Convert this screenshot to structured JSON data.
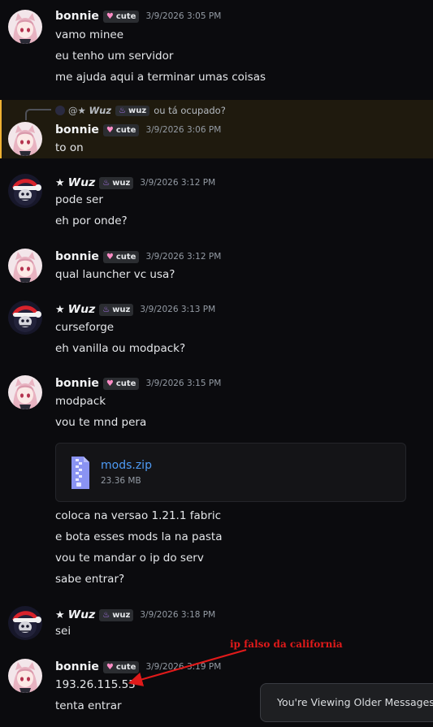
{
  "users": {
    "bonnie": {
      "name": "bonnie",
      "tag": "cute",
      "tag_icon": "heart-icon"
    },
    "wuz": {
      "name": "𝙒𝙪𝙯",
      "star": "★",
      "tag": "wuz",
      "tag_icon": "flame-icon"
    }
  },
  "reply": {
    "mention": "@★ 𝙒𝙪𝙯",
    "tag": "wuz",
    "text": "ou tá ocupado?"
  },
  "messages": [
    {
      "author": "bonnie",
      "time": "3/9/2026 3:05 PM",
      "lines": [
        "vamo minee",
        "eu tenho um servidor",
        "me ajuda aqui a terminar umas coisas"
      ]
    },
    {
      "author": "bonnie",
      "time": "3/9/2026 3:06 PM",
      "lines": [
        "to on"
      ]
    },
    {
      "author": "wuz",
      "time": "3/9/2026 3:12 PM",
      "lines": [
        "pode ser",
        "eh por onde?"
      ]
    },
    {
      "author": "bonnie",
      "time": "3/9/2026 3:12 PM",
      "lines": [
        "qual launcher vc usa?"
      ]
    },
    {
      "author": "wuz",
      "time": "3/9/2026 3:13 PM",
      "lines": [
        "curseforge",
        "eh vanilla ou modpack?"
      ]
    },
    {
      "author": "bonnie",
      "time": "3/9/2026 3:15 PM",
      "lines": [
        "modpack",
        "vou te mnd pera"
      ],
      "lines_after": [
        "coloca na versao 1.21.1 fabric",
        "e bota esses mods la na pasta",
        "vou te mandar o ip do serv",
        "sabe entrar?"
      ]
    },
    {
      "author": "wuz",
      "time": "3/9/2026 3:18 PM",
      "lines": [
        "sei"
      ]
    },
    {
      "author": "bonnie",
      "time": "3/9/2026 3:19 PM",
      "lines": [
        "193.26.115.53",
        "tenta entrar"
      ]
    }
  ],
  "attachment": {
    "name": "mods.zip",
    "size": "23.36 MB",
    "icon": "zip-file-icon"
  },
  "toast": "You're Viewing Older Messages",
  "annotation": "ip falso da california",
  "colors": {
    "accent_link": "#4e9bf5",
    "highlight_bar": "#f0b232",
    "annotation": "#e01a1a"
  }
}
